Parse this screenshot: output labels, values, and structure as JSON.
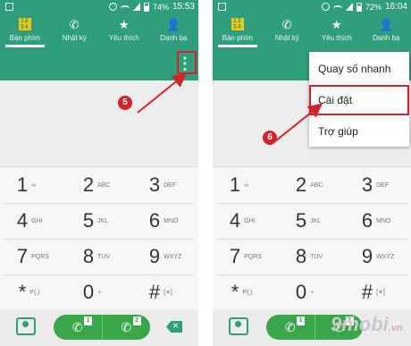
{
  "screens": [
    {
      "status_time": "15:53",
      "battery": "74%",
      "tabs": [
        "Bàn phím",
        "Nhật ký",
        "Yêu thích",
        "Danh bạ"
      ],
      "active_tab": "Bàn phím",
      "step_badge": "5"
    },
    {
      "status_time": "16:04",
      "battery": "72%",
      "tabs": [
        "Bàn phím",
        "Nhật ký",
        "Yêu thích",
        "Danh bạ"
      ],
      "active_tab": "Bàn phím",
      "menu": [
        "Quay số nhanh",
        "Cài đặt",
        "Trợ giúp"
      ],
      "highlighted_menu": "Cài đặt",
      "step_badge": "6"
    }
  ],
  "keypad": [
    {
      "digit": "1",
      "letters": ""
    },
    {
      "digit": "2",
      "letters": "ABC"
    },
    {
      "digit": "3",
      "letters": "DEF"
    },
    {
      "digit": "4",
      "letters": "GHI"
    },
    {
      "digit": "5",
      "letters": "JKL"
    },
    {
      "digit": "6",
      "letters": "MNO"
    },
    {
      "digit": "7",
      "letters": "PQRS"
    },
    {
      "digit": "8",
      "letters": "TUV"
    },
    {
      "digit": "9",
      "letters": "WXYZ"
    },
    {
      "digit": "*",
      "letters": "P(,)"
    },
    {
      "digit": "0",
      "letters": "+"
    },
    {
      "digit": "#",
      "letters": ""
    }
  ],
  "sim_labels": [
    "1",
    "2"
  ],
  "watermark": {
    "main": "9mobi",
    "suffix": ".vn"
  },
  "colors": {
    "header_green": "#2f9e7d",
    "call_green": "#3aa64a",
    "highlight_red": "#d0232a"
  },
  "icons": {
    "tab_icons": [
      "keypad-icon",
      "call-log-icon",
      "star-icon",
      "contacts-icon"
    ],
    "menu_icon": "more-vert-icon",
    "call_icon": "phone-icon",
    "delete_icon": "backspace-icon"
  }
}
